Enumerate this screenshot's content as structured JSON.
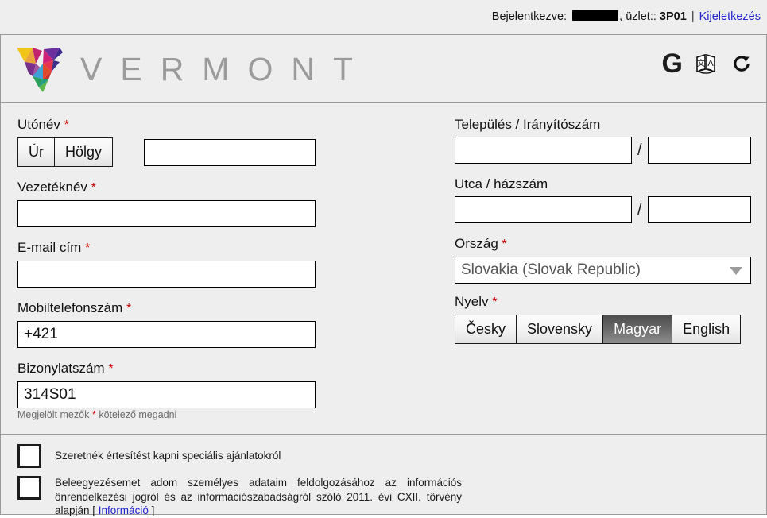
{
  "topbar": {
    "logged_in_label": "Bejelentkezve:",
    "user_redacted": "",
    "store_label": "üzlet::",
    "store_value": "3P01",
    "separator": "|",
    "logout_label": "Kijeletkezés"
  },
  "brand": {
    "wordmark": "VERMONT",
    "icons": {
      "g_label": "G",
      "translate_name": "translate-icon",
      "refresh_name": "refresh-icon"
    }
  },
  "form": {
    "left": {
      "firstname_label": "Utónév",
      "firstname_value": "",
      "salutation_options": [
        "Úr",
        "Hölgy"
      ],
      "salutation_selected": "",
      "lastname_label": "Vezetéknév",
      "lastname_value": "",
      "email_label": "E-mail cím",
      "email_value": "",
      "mobile_label": "Mobiltelefonszám",
      "mobile_value": "+421",
      "receipt_label": "Bizonylatszám",
      "receipt_value": "314S01"
    },
    "right": {
      "city_zip_label": "Település / Irányítószám",
      "city_value": "",
      "zip_value": "",
      "street_no_label": "Utca / házszám",
      "street_value": "",
      "house_no_value": "",
      "country_label": "Ország",
      "country_value": "Slovakia (Slovak Republic)",
      "language_label": "Nyelv",
      "language_options": [
        "Česky",
        "Slovensky",
        "Magyar",
        "English"
      ],
      "language_selected": "Magyar"
    },
    "required_marker": "*",
    "slash": "/",
    "footnote_prefix": "Megjelölt mezők",
    "footnote_marker": "*",
    "footnote_suffix": "kötelező megadni"
  },
  "consents": {
    "marketing_text": "Szeretnék értesítést kapni speciális ajánlatokról",
    "marketing_checked": false,
    "gdpr_text_before": "Beleegyezésemet adom személyes adataim feldolgozásához az információs önrendelkezési jogról és az információszabadságról szóló 2011. évi CXII. törvény alapján [ ",
    "gdpr_link": "Információ",
    "gdpr_text_after": " ]",
    "gdpr_checked": false
  },
  "colors": {
    "page_bg": "#eeeeee",
    "link": "#2222cc",
    "required": "#cc0000",
    "wordmark": "#9b9b9b",
    "selected_button_bg": "#6a6a6a"
  }
}
